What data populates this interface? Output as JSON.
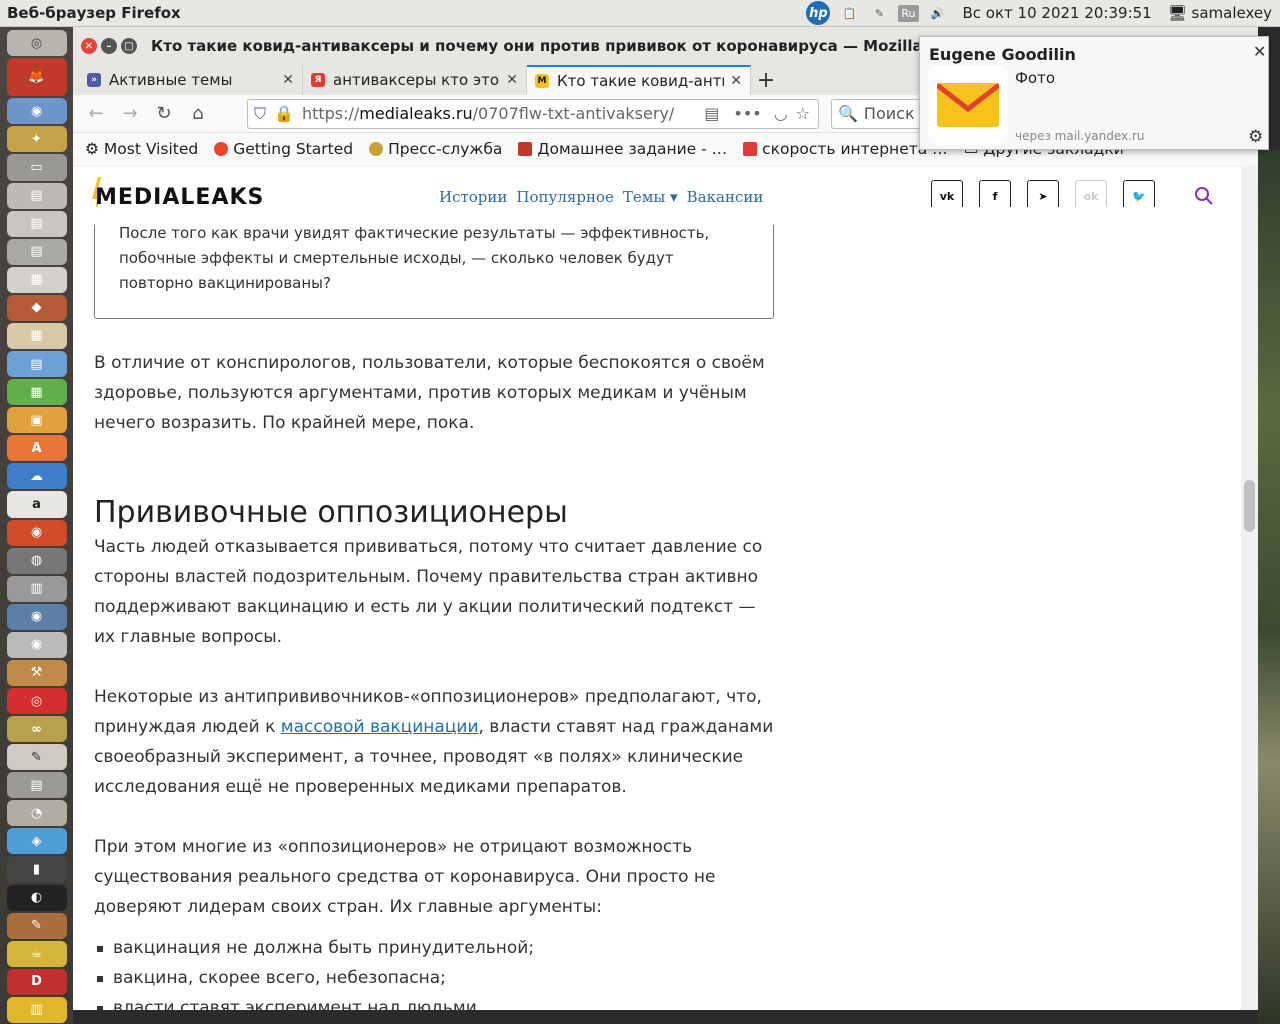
{
  "system": {
    "app_name": "Веб-браузер Firefox",
    "clock": "Вс окт 10 2021 20:39:51",
    "user": "samalexey",
    "lang_indicator": "Ru"
  },
  "window": {
    "title": "Кто такие ковид-антиваксеры и почему они против прививок от коронавируса — Mozilla Firefox"
  },
  "tabs": [
    {
      "label": "Активные темы",
      "favicon": "forum-icon",
      "active": false
    },
    {
      "label": "антиваксеры кто это",
      "favicon": "yandex-icon",
      "active": false
    },
    {
      "label": "Кто такие ковид-антиваксеры",
      "favicon": "medialeaks-icon",
      "active": true
    }
  ],
  "navbar": {
    "url_prefix": "https://",
    "url_domain": "medialeaks.ru",
    "url_path": "/0707flw-txt-antivaksery/",
    "search_placeholder": "Поиск"
  },
  "bookmarks": [
    "Most Visited",
    "Getting Started",
    "Пресс-служба",
    "Домашнее задание - …",
    "скорость интернета …",
    "Другие закладки"
  ],
  "site": {
    "logo": "MEDIALEAKS",
    "menu": [
      "Истории",
      "Популярное",
      "Темы ▾",
      "Вакансии"
    ],
    "social": [
      "vk",
      "f",
      "tg",
      "ok",
      "tw"
    ]
  },
  "article": {
    "quote": "После того как врачи увидят фактические результаты — эффективность, побочные эффекты и смертельные исходы, — сколько человек будут повторно вакцинированы?",
    "p1": "В отличие от конспирологов, пользователи, которые беспокоятся о своём здоровье, пользуются аргументами, против которых медикам и учёным нечего возразить. По крайней мере, пока.",
    "h2": "Прививочные оппозиционеры",
    "p2": "Часть людей отказывается прививаться, потому что считает давление со стороны властей подозрительным. Почему правительства стран активно поддерживают вакцинацию и есть ли у акции политический подтекст — их главные вопросы.",
    "p3_a": "Некоторые из антипрививочников-«оппозиционеров» предполагают, что, принуждая людей к ",
    "p3_link": "массовой вакцинации",
    "p3_b": ", власти ставят над гражданами своеобразный эксперимент, а точнее, проводят «в полях» клинические исследования ещё не проверенных медиками препаратов.",
    "p4": "При этом многие из «оппозиционеров» не отрицают возможность существования реального средства от коронавируса. Они просто не доверяют лидерам своих стран. Их главные аргументы:",
    "list": [
      "вакцинация не должна быть принудительной;",
      "вакцина, скорее всего, небезопасна;",
      "власти ставят эксперимент над людьми"
    ]
  },
  "notification": {
    "sender": "Eugene Goodilin",
    "body": "Фото",
    "via": "через mail.yandex.ru"
  }
}
